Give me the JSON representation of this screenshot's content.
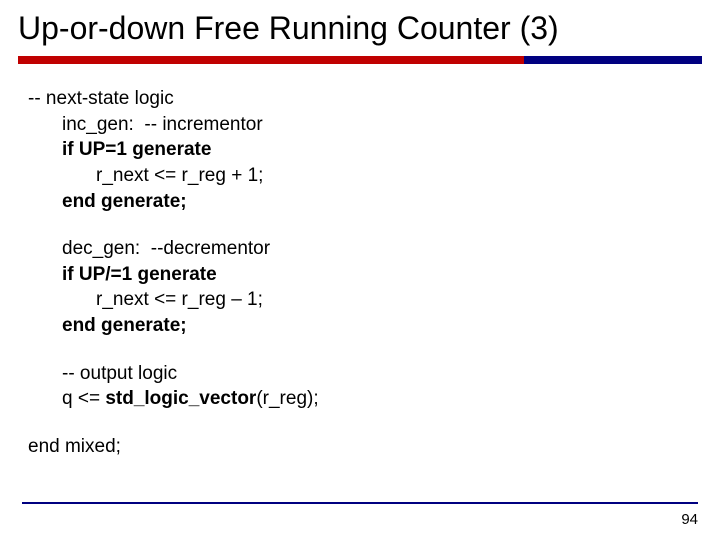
{
  "slide": {
    "title": "Up-or-down Free Running Counter (3)",
    "page_number": "94"
  },
  "code": {
    "comment_next_state": "-- next-state logic",
    "inc_label": "inc_gen:",
    "inc_comment": "  -- incrementor",
    "if_up_eq": "if UP=1 generate",
    "inc_body": "r_next <= r_reg + 1;",
    "end_generate1": "end generate;",
    "dec_label": "dec_gen:",
    "dec_comment": "  --decrementor",
    "if_up_neq": "if UP/=1 generate",
    "dec_body": "r_next <= r_reg – 1;",
    "end_generate2": "end generate;",
    "comment_output": "-- output logic",
    "q_assign_pre": "q <= ",
    "std_logic_vector": "std_logic_vector",
    "q_assign_post": "(r_reg);",
    "end_mixed": "end mixed;"
  }
}
